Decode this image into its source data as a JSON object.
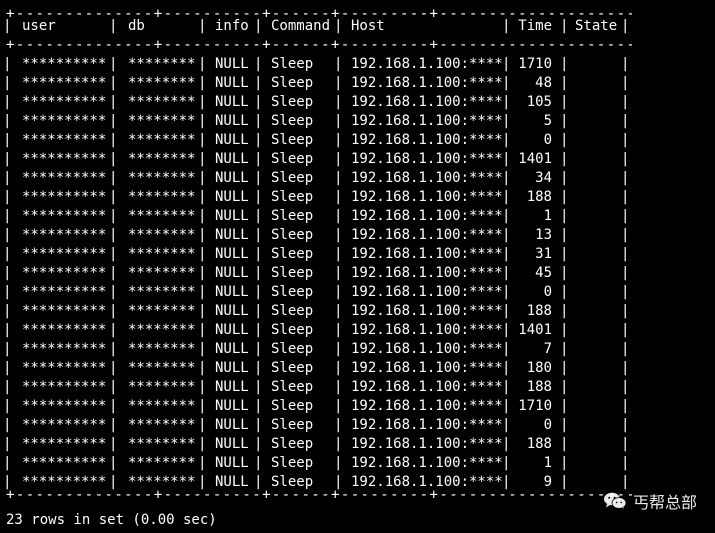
{
  "table": {
    "border": "+--------------+----------+------+---------+---------------------+------+-------+",
    "columns": [
      "user",
      "db",
      "info",
      "Command",
      "Host",
      "Time",
      "State"
    ],
    "rows": [
      {
        "user": "**********",
        "db": "********",
        "info": "NULL",
        "command": "Sleep",
        "host": "192.168.1.100:****",
        "time": "1710",
        "state": ""
      },
      {
        "user": "**********",
        "db": "********",
        "info": "NULL",
        "command": "Sleep",
        "host": "192.168.1.100:****",
        "time": "48",
        "state": ""
      },
      {
        "user": "**********",
        "db": "********",
        "info": "NULL",
        "command": "Sleep",
        "host": "192.168.1.100:****",
        "time": "105",
        "state": ""
      },
      {
        "user": "**********",
        "db": "********",
        "info": "NULL",
        "command": "Sleep",
        "host": "192.168.1.100:****",
        "time": "5",
        "state": ""
      },
      {
        "user": "**********",
        "db": "********",
        "info": "NULL",
        "command": "Sleep",
        "host": "192.168.1.100:****",
        "time": "0",
        "state": ""
      },
      {
        "user": "**********",
        "db": "********",
        "info": "NULL",
        "command": "Sleep",
        "host": "192.168.1.100:****",
        "time": "1401",
        "state": ""
      },
      {
        "user": "**********",
        "db": "********",
        "info": "NULL",
        "command": "Sleep",
        "host": "192.168.1.100:****",
        "time": "34",
        "state": ""
      },
      {
        "user": "**********",
        "db": "********",
        "info": "NULL",
        "command": "Sleep",
        "host": "192.168.1.100:****",
        "time": "188",
        "state": ""
      },
      {
        "user": "**********",
        "db": "********",
        "info": "NULL",
        "command": "Sleep",
        "host": "192.168.1.100:****",
        "time": "1",
        "state": ""
      },
      {
        "user": "**********",
        "db": "********",
        "info": "NULL",
        "command": "Sleep",
        "host": "192.168.1.100:****",
        "time": "13",
        "state": ""
      },
      {
        "user": "**********",
        "db": "********",
        "info": "NULL",
        "command": "Sleep",
        "host": "192.168.1.100:****",
        "time": "31",
        "state": ""
      },
      {
        "user": "**********",
        "db": "********",
        "info": "NULL",
        "command": "Sleep",
        "host": "192.168.1.100:****",
        "time": "45",
        "state": ""
      },
      {
        "user": "**********",
        "db": "********",
        "info": "NULL",
        "command": "Sleep",
        "host": "192.168.1.100:****",
        "time": "0",
        "state": ""
      },
      {
        "user": "**********",
        "db": "********",
        "info": "NULL",
        "command": "Sleep",
        "host": "192.168.1.100:****",
        "time": "188",
        "state": ""
      },
      {
        "user": "**********",
        "db": "********",
        "info": "NULL",
        "command": "Sleep",
        "host": "192.168.1.100:****",
        "time": "1401",
        "state": ""
      },
      {
        "user": "**********",
        "db": "********",
        "info": "NULL",
        "command": "Sleep",
        "host": "192.168.1.100:****",
        "time": "7",
        "state": ""
      },
      {
        "user": "**********",
        "db": "********",
        "info": "NULL",
        "command": "Sleep",
        "host": "192.168.1.100:****",
        "time": "180",
        "state": ""
      },
      {
        "user": "**********",
        "db": "********",
        "info": "NULL",
        "command": "Sleep",
        "host": "192.168.1.100:****",
        "time": "188",
        "state": ""
      },
      {
        "user": "**********",
        "db": "********",
        "info": "NULL",
        "command": "Sleep",
        "host": "192.168.1.100:****",
        "time": "1710",
        "state": ""
      },
      {
        "user": "**********",
        "db": "********",
        "info": "NULL",
        "command": "Sleep",
        "host": "192.168.1.100:****",
        "time": "0",
        "state": ""
      },
      {
        "user": "**********",
        "db": "********",
        "info": "NULL",
        "command": "Sleep",
        "host": "192.168.1.100:****",
        "time": "188",
        "state": ""
      },
      {
        "user": "**********",
        "db": "********",
        "info": "NULL",
        "command": "Sleep",
        "host": "192.168.1.100:****",
        "time": "1",
        "state": ""
      },
      {
        "user": "**********",
        "db": "********",
        "info": "NULL",
        "command": "Sleep",
        "host": "192.168.1.100:****",
        "time": "9",
        "state": ""
      }
    ]
  },
  "footer": "23 rows in set (0.00 sec)",
  "watermark": {
    "icon": "wechat-icon",
    "text": "丐帮总部"
  },
  "colors": {
    "background": "#000000",
    "text": "#ffffff"
  }
}
